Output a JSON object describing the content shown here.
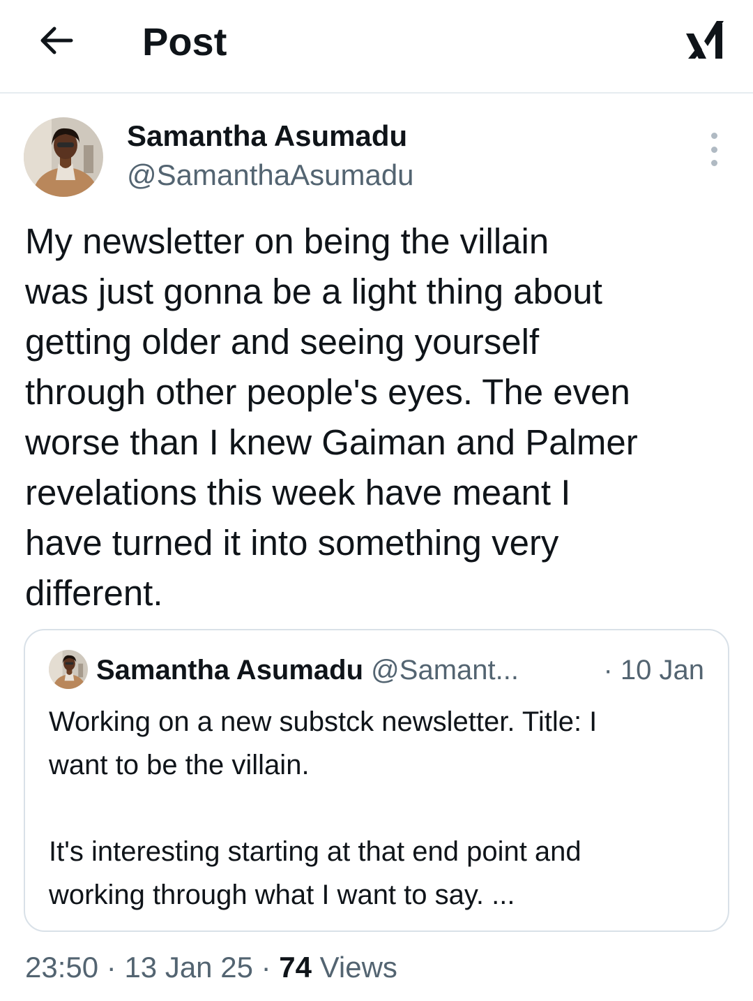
{
  "header": {
    "title": "Post",
    "back_icon": "arrow-left-icon",
    "logo_icon": "x-logo-icon"
  },
  "post": {
    "author": {
      "name": "Samantha Asumadu",
      "handle": "@SamanthaAsumadu"
    },
    "text": "My newsletter on being the villain\nwas just gonna be a light thing about\ngetting older and seeing yourself\nthrough other people's eyes. The even\nworse than I knew Gaiman and Palmer\nrevelations this week have meant I\nhave turned it into something very\ndifferent.",
    "quoted": {
      "name": "Samantha Asumadu",
      "handle": "@Samant...",
      "date": "· 10 Jan",
      "text": "Working on a new substck newsletter. Title: I\nwant to be the villain.\n\nIt's interesting starting at that end point and\nworking through what I want to say. ..."
    },
    "meta": {
      "time": "23:50",
      "sep1": " · ",
      "date": "13 Jan 25",
      "sep2": " · ",
      "views_count": "74",
      "views_label": "Views"
    }
  },
  "colors": {
    "text": "#0f1419",
    "secondary": "#536471",
    "border": "#d9e1e8"
  }
}
